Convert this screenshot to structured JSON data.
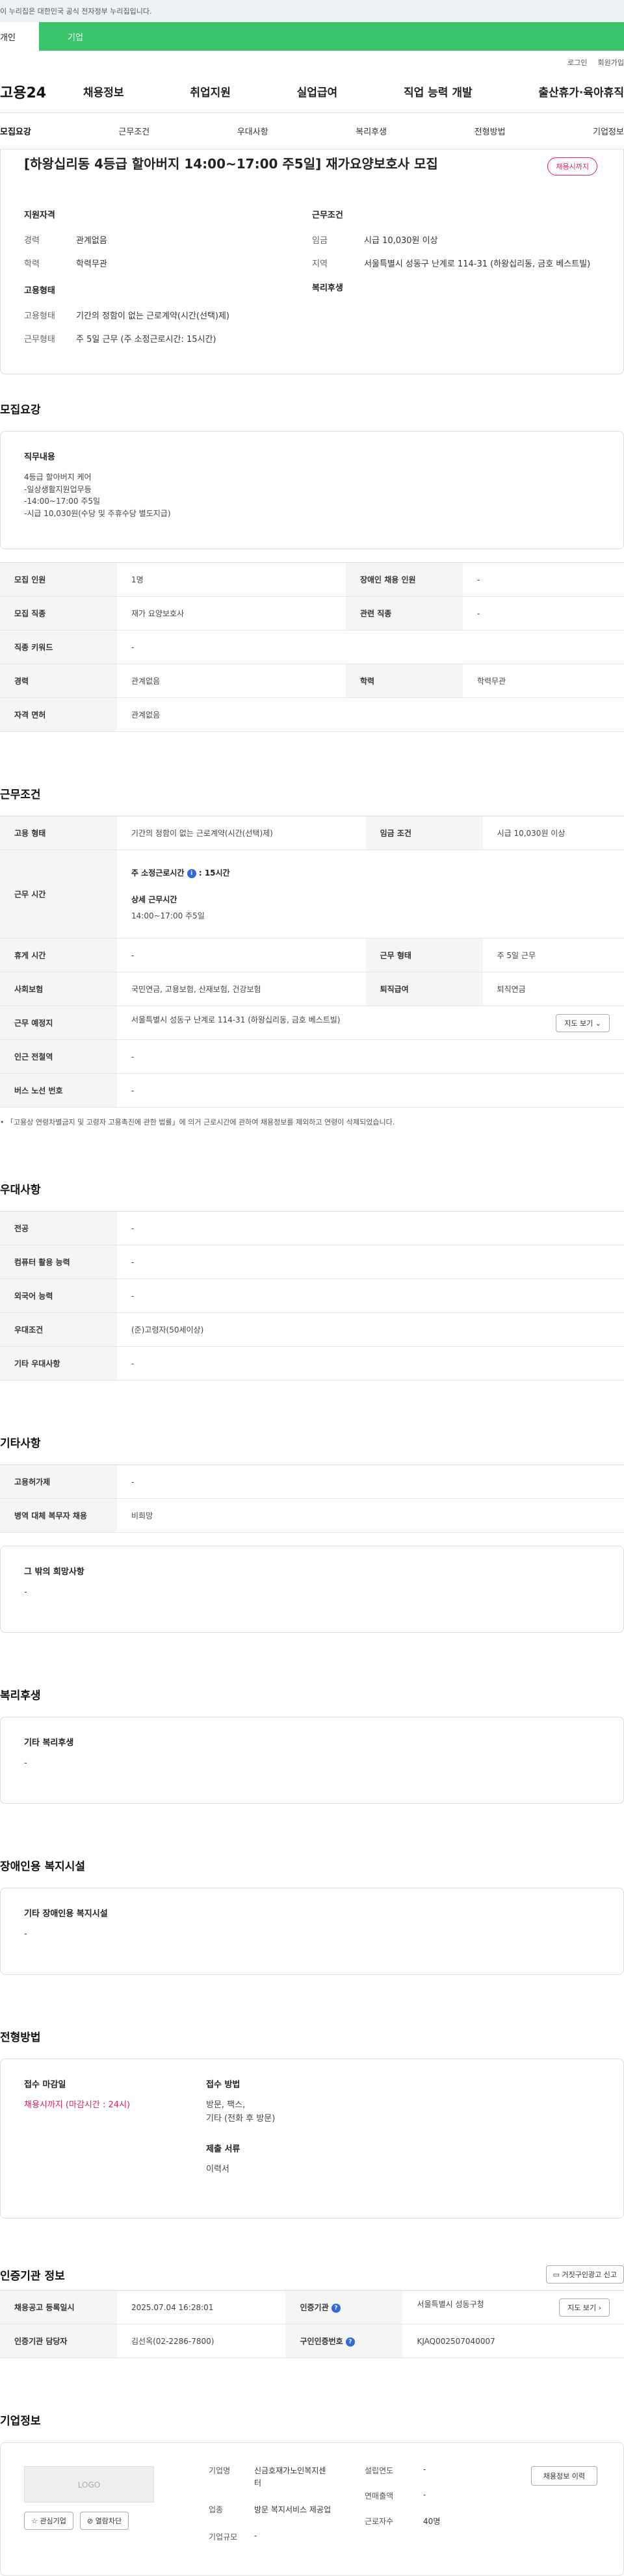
{
  "gov_banner": "이 누리집은 대한민국 공식 전자정부 누리집입니다.",
  "user_tabs": {
    "personal": "개인",
    "company": "기업"
  },
  "util_links": [
    "로그인",
    "회원가입"
  ],
  "logo": "고용24",
  "gnb": [
    "채용정보",
    "취업지원",
    "실업급여",
    "직업 능력 개발",
    "출산휴가·육아휴직"
  ],
  "lnb": [
    "모집요강",
    "근무조건",
    "우대사항",
    "복리후생",
    "전형방법",
    "기업정보"
  ],
  "summary": {
    "title": "[하왕십리동 4등급 할아버지 14:00~17:00 주5일] 재가요양보호사 모집",
    "badge": "채용시까지",
    "left_head": "지원자격",
    "career_k": "경력",
    "career_v": "관계없음",
    "edu_k": "학력",
    "edu_v": "학력무관",
    "emp_head": "고용형태",
    "emptype_k": "고용형태",
    "emptype_v": "기간의 정함이 없는 근로계약(시간(선택)제)",
    "workform_k": "근무형태",
    "workform_v": "주 5일 근무 (주 소정근로시간: 15시간)",
    "right_head": "근무조건",
    "wage_k": "임금",
    "wage_v": "시급 10,030원 이상",
    "region_k": "지역",
    "region_v": "서울특별시 성동구 난계로 114-31 (하왕십리동, 금호 베스트빌)",
    "welfare_head": "복리후생"
  },
  "recruit": {
    "title": "모집요강",
    "duty_head": "직무내용",
    "duty_body": "4등급 할아버지 케어\n-일상생활지원업무등\n-14:00~17:00 주5일\n-시급 10,030원(수당 및 주휴수당 별도지급)",
    "rows": [
      [
        "모집 인원",
        "1명",
        "장애인 채용 인원",
        "-"
      ],
      [
        "모집 직종",
        "재가 요양보호사",
        "관련 직종",
        "-"
      ],
      [
        "직종 키워드",
        "-",
        "",
        ""
      ],
      [
        "경력",
        "관계없음",
        "학력",
        "학력무관"
      ],
      [
        "자격 면허",
        "관계없음",
        "",
        ""
      ]
    ]
  },
  "work": {
    "title": "근무조건",
    "emptype_k": "고용 형태",
    "emptype_v": "기간의 정함이 없는 근로계약(시간(선택)제)",
    "wagecond_k": "임금 조건",
    "wagecond_v": "시급 10,030원 이상",
    "worktime_k": "근무 시간",
    "weekly_label": "주 소정근로시간",
    "weekly_value": ": 15시간",
    "detail_label": "상세 근무시간",
    "detail_value": "14:00~17:00 주5일",
    "rest_k": "휴게 시간",
    "rest_v": "-",
    "workform_k": "근무 형태",
    "workform_v": "주 5일 근무",
    "insurance_k": "사회보험",
    "insurance_v": "국민연금, 고용보험, 산재보험, 건강보험",
    "severance_k": "퇴직급여",
    "severance_v": "퇴직연금",
    "place_k": "근무 예정지",
    "place_v": "서울특별시 성동구 난계로 114-31 (하왕십리동, 금호 베스트빌)",
    "map_btn": "지도 보기",
    "station_k": "인근 전철역",
    "station_v": "-",
    "bus_k": "버스 노선 번호",
    "bus_v": "-",
    "note": "「고용상 연령차별금지 및 고령자 고용촉진에 관한 법률」에 의거 근로시간에 관하여 채용정보를 제외하고 연령이 삭제되었습니다."
  },
  "prefer": {
    "title": "우대사항",
    "rows": [
      [
        "전공",
        "-"
      ],
      [
        "컴퓨터 활용 능력",
        "-"
      ],
      [
        "외국어 능력",
        "-"
      ],
      [
        "우대조건",
        "(준)고령자(50세이상)"
      ],
      [
        "기타 우대사항",
        "-"
      ]
    ]
  },
  "etc": {
    "title": "기타사항",
    "rows": [
      [
        "고용허가제",
        "-"
      ],
      [
        "병역 대체 복무자 채용",
        "비희망"
      ]
    ],
    "hope_head": "그 밖의 희망사항",
    "hope_val": "-"
  },
  "welfare": {
    "title": "복리후생",
    "head": "기타 복리후생",
    "val": "-"
  },
  "facility": {
    "title": "장애인용 복지시설",
    "head": "기타 장애인용 복지시설",
    "val": "-"
  },
  "selection": {
    "title": "전형방법",
    "deadline_head": "접수 마감일",
    "deadline_val": "채용시까지 (마감시간 : 24시)",
    "method_head": "접수 방법",
    "method_val": "방문, 팩스,\n기타 (전화 후 방문)",
    "docs_head": "제출 서류",
    "docs_val": "이력서"
  },
  "cert": {
    "title": "인증기관 정보",
    "report_btn": "거짓구인광고 신고",
    "rows": [
      [
        "채용공고 등록일시",
        "2025.07.04 16:28:01",
        "인증기관",
        "서울특별시 성동구청"
      ],
      [
        "인증기관 담당자",
        "김선옥(02-2286-7800)",
        "구인인증번호",
        "KJAQ002507040007"
      ]
    ],
    "map_btn": "지도 보기"
  },
  "company": {
    "title": "기업정보",
    "logo": "LOGO",
    "fav_btn": "관심기업",
    "block_btn": "열람차단",
    "name_k": "기업명",
    "name_v": "신금호재가노인복지센터",
    "industry_k": "업종",
    "industry_v": "방문 복지서비스 제공업",
    "size_k": "기업규모",
    "size_v": "-",
    "year_k": "설립연도",
    "year_v": "-",
    "sales_k": "연매출액",
    "sales_v": "-",
    "emp_k": "근로자수",
    "emp_v": "40명",
    "history_btn": "채용정보 이력"
  }
}
